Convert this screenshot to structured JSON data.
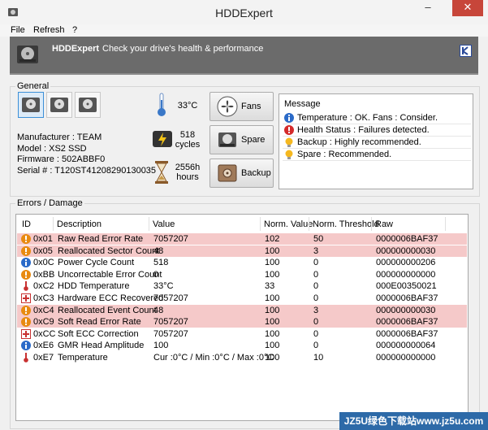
{
  "window": {
    "title": "HDDExpert",
    "minimize": "–",
    "maximize": "□",
    "close": "✕"
  },
  "menu": [
    "File",
    "Refresh",
    "?"
  ],
  "banner": {
    "title": "HDDExpert",
    "subtitle": "Check your drive's health & performance"
  },
  "general": {
    "label": "General",
    "info": {
      "manufacturer": "Manufacturer : TEAM",
      "model": "Model : XS2 SSD",
      "firmware": "Firmware : 502ABBF0",
      "serial": "Serial # : T120ST41208290130035"
    },
    "stats": {
      "temperature": "33°C",
      "cycles_value": "518",
      "cycles_unit": "cycles",
      "hours_value": "2556h",
      "hours_unit": "hours"
    },
    "buttons": {
      "fans": "Fans",
      "spare": "Spare",
      "backup": "Backup"
    }
  },
  "messages": {
    "title": "Message",
    "items": [
      {
        "icon": "info",
        "text": "Temperature : OK. Fans : Consider."
      },
      {
        "icon": "error",
        "text": "Health Status : Failures detected."
      },
      {
        "icon": "bulb",
        "text": "Backup : Highly recommended."
      },
      {
        "icon": "bulb",
        "text": "Spare : Recommended."
      }
    ]
  },
  "errors": {
    "label": "Errors / Damage",
    "headers": [
      "ID",
      "Description",
      "Value",
      "Norm. Value",
      "Norm. Threshold",
      "Raw"
    ],
    "rows": [
      {
        "icon": "warn",
        "hl": true,
        "id": "0x01",
        "desc": "Raw Read Error Rate",
        "value": "7057207",
        "norm": "102",
        "thresh": "50",
        "raw": "0000006BAF37"
      },
      {
        "icon": "warn",
        "hl": true,
        "id": "0x05",
        "desc": "Reallocated Sector Count",
        "value": "48",
        "norm": "100",
        "thresh": "3",
        "raw": "000000000030"
      },
      {
        "icon": "ok",
        "hl": false,
        "id": "0x0C",
        "desc": "Power Cycle Count",
        "value": "518",
        "norm": "100",
        "thresh": "0",
        "raw": "000000000206"
      },
      {
        "icon": "warn",
        "hl": false,
        "id": "0xBB",
        "desc": "Uncorrectable Error Count",
        "value": "0",
        "norm": "100",
        "thresh": "0",
        "raw": "000000000000"
      },
      {
        "icon": "temp",
        "hl": false,
        "id": "0xC2",
        "desc": "HDD Temperature",
        "value": "33°C",
        "norm": "33",
        "thresh": "0",
        "raw": "000E00350021"
      },
      {
        "icon": "plus",
        "hl": false,
        "id": "0xC3",
        "desc": "Hardware ECC Recovered",
        "value": "7057207",
        "norm": "100",
        "thresh": "0",
        "raw": "0000006BAF37"
      },
      {
        "icon": "warn",
        "hl": true,
        "id": "0xC4",
        "desc": "Reallocated Event Count",
        "value": "48",
        "norm": "100",
        "thresh": "3",
        "raw": "000000000030"
      },
      {
        "icon": "warn",
        "hl": true,
        "id": "0xC9",
        "desc": "Soft Read Error Rate",
        "value": "7057207",
        "norm": "100",
        "thresh": "0",
        "raw": "0000006BAF37"
      },
      {
        "icon": "plus",
        "hl": false,
        "id": "0xCC",
        "desc": "Soft ECC Correction",
        "value": "7057207",
        "norm": "100",
        "thresh": "0",
        "raw": "0000006BAF37"
      },
      {
        "icon": "info",
        "hl": false,
        "id": "0xE6",
        "desc": "GMR Head Amplitude",
        "value": "100",
        "norm": "100",
        "thresh": "0",
        "raw": "000000000064"
      },
      {
        "icon": "temp",
        "hl": false,
        "id": "0xE7",
        "desc": "Temperature",
        "value": "Cur :0°C / Min :0°C / Max :0°C",
        "norm": "100",
        "thresh": "10",
        "raw": "000000000000"
      }
    ]
  },
  "watermark": "JZ5U绿色下载站www.jz5u.com",
  "colors": {
    "warn_row": "#f5c9c9",
    "banner": "#6b6b6b",
    "close": "#c7463a",
    "accent": "#3b8fd8"
  }
}
